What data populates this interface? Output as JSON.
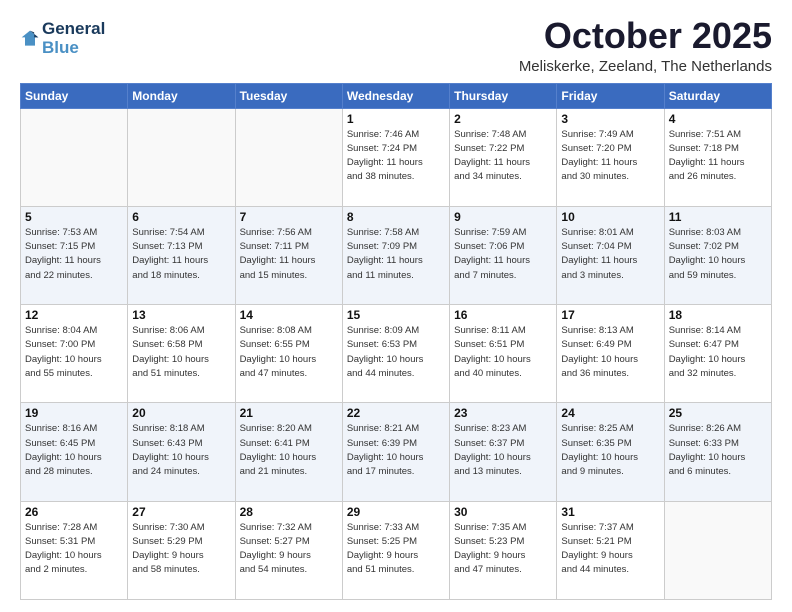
{
  "header": {
    "logo_line1": "General",
    "logo_line2": "Blue",
    "month_title": "October 2025",
    "location": "Meliskerke, Zeeland, The Netherlands"
  },
  "days_of_week": [
    "Sunday",
    "Monday",
    "Tuesday",
    "Wednesday",
    "Thursday",
    "Friday",
    "Saturday"
  ],
  "weeks": [
    [
      {
        "day": "",
        "info": ""
      },
      {
        "day": "",
        "info": ""
      },
      {
        "day": "",
        "info": ""
      },
      {
        "day": "1",
        "info": "Sunrise: 7:46 AM\nSunset: 7:24 PM\nDaylight: 11 hours\nand 38 minutes."
      },
      {
        "day": "2",
        "info": "Sunrise: 7:48 AM\nSunset: 7:22 PM\nDaylight: 11 hours\nand 34 minutes."
      },
      {
        "day": "3",
        "info": "Sunrise: 7:49 AM\nSunset: 7:20 PM\nDaylight: 11 hours\nand 30 minutes."
      },
      {
        "day": "4",
        "info": "Sunrise: 7:51 AM\nSunset: 7:18 PM\nDaylight: 11 hours\nand 26 minutes."
      }
    ],
    [
      {
        "day": "5",
        "info": "Sunrise: 7:53 AM\nSunset: 7:15 PM\nDaylight: 11 hours\nand 22 minutes."
      },
      {
        "day": "6",
        "info": "Sunrise: 7:54 AM\nSunset: 7:13 PM\nDaylight: 11 hours\nand 18 minutes."
      },
      {
        "day": "7",
        "info": "Sunrise: 7:56 AM\nSunset: 7:11 PM\nDaylight: 11 hours\nand 15 minutes."
      },
      {
        "day": "8",
        "info": "Sunrise: 7:58 AM\nSunset: 7:09 PM\nDaylight: 11 hours\nand 11 minutes."
      },
      {
        "day": "9",
        "info": "Sunrise: 7:59 AM\nSunset: 7:06 PM\nDaylight: 11 hours\nand 7 minutes."
      },
      {
        "day": "10",
        "info": "Sunrise: 8:01 AM\nSunset: 7:04 PM\nDaylight: 11 hours\nand 3 minutes."
      },
      {
        "day": "11",
        "info": "Sunrise: 8:03 AM\nSunset: 7:02 PM\nDaylight: 10 hours\nand 59 minutes."
      }
    ],
    [
      {
        "day": "12",
        "info": "Sunrise: 8:04 AM\nSunset: 7:00 PM\nDaylight: 10 hours\nand 55 minutes."
      },
      {
        "day": "13",
        "info": "Sunrise: 8:06 AM\nSunset: 6:58 PM\nDaylight: 10 hours\nand 51 minutes."
      },
      {
        "day": "14",
        "info": "Sunrise: 8:08 AM\nSunset: 6:55 PM\nDaylight: 10 hours\nand 47 minutes."
      },
      {
        "day": "15",
        "info": "Sunrise: 8:09 AM\nSunset: 6:53 PM\nDaylight: 10 hours\nand 44 minutes."
      },
      {
        "day": "16",
        "info": "Sunrise: 8:11 AM\nSunset: 6:51 PM\nDaylight: 10 hours\nand 40 minutes."
      },
      {
        "day": "17",
        "info": "Sunrise: 8:13 AM\nSunset: 6:49 PM\nDaylight: 10 hours\nand 36 minutes."
      },
      {
        "day": "18",
        "info": "Sunrise: 8:14 AM\nSunset: 6:47 PM\nDaylight: 10 hours\nand 32 minutes."
      }
    ],
    [
      {
        "day": "19",
        "info": "Sunrise: 8:16 AM\nSunset: 6:45 PM\nDaylight: 10 hours\nand 28 minutes."
      },
      {
        "day": "20",
        "info": "Sunrise: 8:18 AM\nSunset: 6:43 PM\nDaylight: 10 hours\nand 24 minutes."
      },
      {
        "day": "21",
        "info": "Sunrise: 8:20 AM\nSunset: 6:41 PM\nDaylight: 10 hours\nand 21 minutes."
      },
      {
        "day": "22",
        "info": "Sunrise: 8:21 AM\nSunset: 6:39 PM\nDaylight: 10 hours\nand 17 minutes."
      },
      {
        "day": "23",
        "info": "Sunrise: 8:23 AM\nSunset: 6:37 PM\nDaylight: 10 hours\nand 13 minutes."
      },
      {
        "day": "24",
        "info": "Sunrise: 8:25 AM\nSunset: 6:35 PM\nDaylight: 10 hours\nand 9 minutes."
      },
      {
        "day": "25",
        "info": "Sunrise: 8:26 AM\nSunset: 6:33 PM\nDaylight: 10 hours\nand 6 minutes."
      }
    ],
    [
      {
        "day": "26",
        "info": "Sunrise: 7:28 AM\nSunset: 5:31 PM\nDaylight: 10 hours\nand 2 minutes."
      },
      {
        "day": "27",
        "info": "Sunrise: 7:30 AM\nSunset: 5:29 PM\nDaylight: 9 hours\nand 58 minutes."
      },
      {
        "day": "28",
        "info": "Sunrise: 7:32 AM\nSunset: 5:27 PM\nDaylight: 9 hours\nand 54 minutes."
      },
      {
        "day": "29",
        "info": "Sunrise: 7:33 AM\nSunset: 5:25 PM\nDaylight: 9 hours\nand 51 minutes."
      },
      {
        "day": "30",
        "info": "Sunrise: 7:35 AM\nSunset: 5:23 PM\nDaylight: 9 hours\nand 47 minutes."
      },
      {
        "day": "31",
        "info": "Sunrise: 7:37 AM\nSunset: 5:21 PM\nDaylight: 9 hours\nand 44 minutes."
      },
      {
        "day": "",
        "info": ""
      }
    ]
  ]
}
